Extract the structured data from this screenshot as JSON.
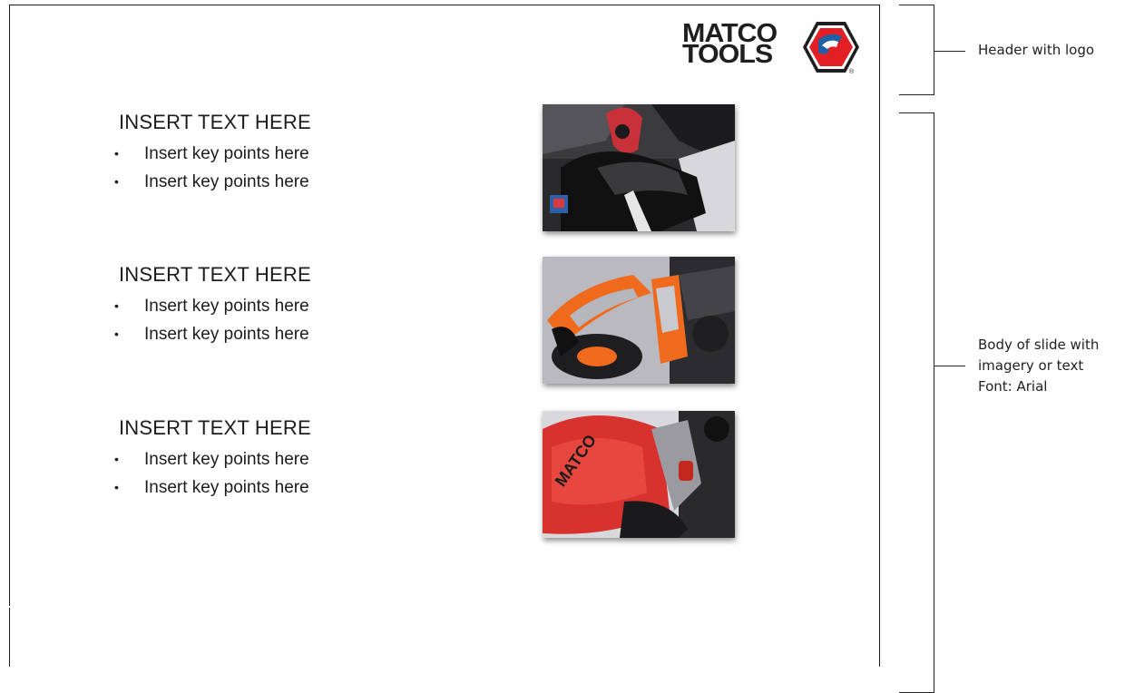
{
  "logo": {
    "line1": "MATCO",
    "line2": "TOOLS",
    "registered": "®",
    "colors": {
      "red": "#e31f26",
      "blue": "#1f5fa8",
      "dark": "#1f1f1f"
    }
  },
  "blocks": [
    {
      "heading": "INSERT TEXT HERE",
      "points": [
        "Insert key points here",
        "Insert key points here"
      ]
    },
    {
      "heading": "INSERT TEXT HERE",
      "points": [
        "Insert key points here",
        "Insert key points here"
      ]
    },
    {
      "heading": "INSERT TEXT HERE",
      "points": [
        "Insert key points here",
        "Insert key points here"
      ]
    }
  ],
  "photos": [
    {
      "subject": "gloved hand holding red tool"
    },
    {
      "subject": "orange and grey screwdriver handles"
    },
    {
      "subject": "red Matco Tools impact wrench"
    }
  ],
  "annotations": {
    "header": "Header with logo",
    "body_line1": "Body of slide with",
    "body_line2": "imagery or text",
    "body_line3": "Font: Arial"
  }
}
